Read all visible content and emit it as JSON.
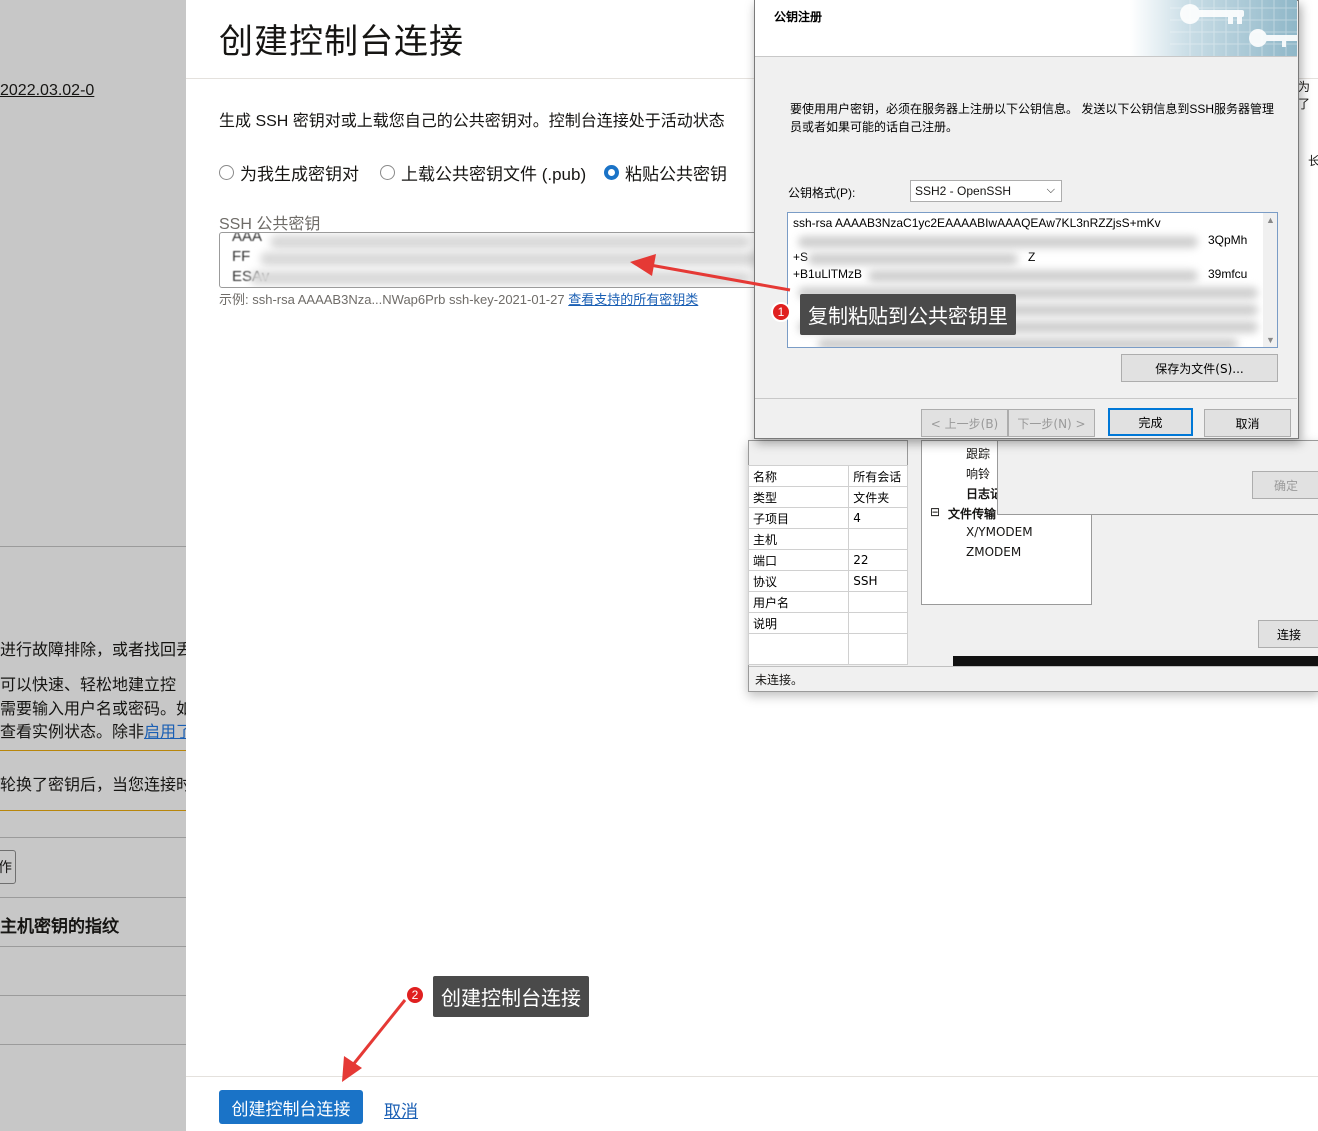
{
  "background_page": {
    "version_link": "2022.03.02-0",
    "text_lines": [
      "进行故障排除，或者找回丢",
      "可以快速、轻松地建立控",
      "需要输入用户名或密码。如",
      "查看实例状态。除非",
      "启用了",
      "轮换了密钥后，当您连接时",
      "主机密钥的指纹"
    ],
    "small_button": "作"
  },
  "panel": {
    "title": "创建控制台连接",
    "description": "生成 SSH 密钥对或上载您自己的公共密钥对。控制台连接处于活动状态",
    "radio_options": [
      {
        "label": "为我生成密钥对",
        "selected": false
      },
      {
        "label": "上载公共密钥文件 (.pub)",
        "selected": false
      },
      {
        "label": "粘贴公共密钥",
        "selected": true
      }
    ],
    "ssh_label": "SSH 公共密钥",
    "ssh_lines": [
      "AAA",
      "FF",
      "ESAv"
    ],
    "example_prefix": "示例: ssh-rsa AAAAB3Nza...NWap6Prb ssh-key-2021-01-27",
    "example_link": "查看支持的所有密钥类",
    "create_button": "创建控制台连接",
    "cancel_link": "取消"
  },
  "annotations": [
    {
      "badge": "1",
      "text": "复制粘贴到公共密钥里"
    },
    {
      "badge": "2",
      "text": "创建控制台连接"
    }
  ],
  "key_dialog": {
    "title": "公钥注册",
    "description": "要使用用户密钥，必须在服务器上注册以下公钥信息。 发送以下公钥信息到SSH服务器管理员或者如果可能的话自己注册。",
    "format_label": "公钥格式(P):",
    "format_value": "SSH2 - OpenSSH",
    "key_lines": [
      "ssh-rsa AAAAB3NzaC1yc2EAAAABIwAAAQEAw7KL3nRZZjsS+mKv",
      "3QpMh",
      "+S",
      "Z",
      "+B1uLlTMzB",
      "39mfcu"
    ],
    "save_button": "保存为文件(S)...",
    "prev_button": "< 上一步(B)",
    "next_button": "下一步(N) >",
    "finish_button": "完成",
    "cancel_button": "取消"
  },
  "session_props": {
    "rows": [
      [
        "名称",
        "所有会话"
      ],
      [
        "类型",
        "文件夹"
      ],
      [
        "子项目",
        "4"
      ],
      [
        "主机",
        ""
      ],
      [
        "端口",
        "22"
      ],
      [
        "协议",
        "SSH"
      ],
      [
        "用户名",
        ""
      ],
      [
        "说明",
        ""
      ]
    ],
    "tree_items": [
      "跟踪",
      "响铃",
      "日志记",
      "文件传输",
      "X/YMODEM",
      "ZMODEM"
    ],
    "confirm_button": "确定",
    "connect_button": "连接",
    "status": "未连接。",
    "edge_text_1": "为了",
    "edge_text_2": "长"
  }
}
